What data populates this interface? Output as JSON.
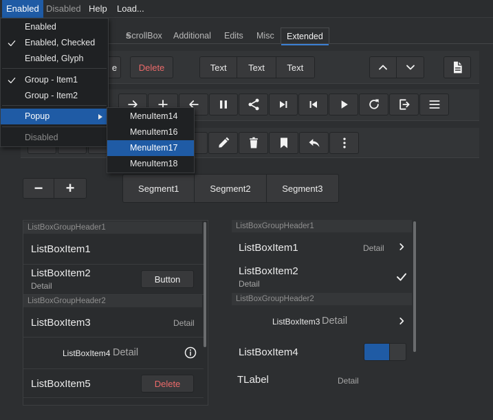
{
  "menubar": {
    "items": [
      {
        "label": "Enabled"
      },
      {
        "label": "Disabled"
      },
      {
        "label": "Help"
      },
      {
        "label": "Load..."
      }
    ]
  },
  "dropdown": {
    "items": [
      {
        "label": "Enabled"
      },
      {
        "label": "Enabled, Checked"
      },
      {
        "label": "Enabled, Glyph"
      },
      {
        "label": "Group - Item1"
      },
      {
        "label": "Group - Item2"
      },
      {
        "label": "Popup"
      },
      {
        "label": "Disabled"
      }
    ],
    "submenu": [
      "MenuItem14",
      "MenuItem16",
      "MenuItem17",
      "MenuItem18"
    ]
  },
  "tabs": [
    {
      "label": "s"
    },
    {
      "label": "ScrollBox"
    },
    {
      "label": "Additional"
    },
    {
      "label": "Edits"
    },
    {
      "label": "Misc"
    },
    {
      "label": "Extended"
    }
  ],
  "row1": {
    "partial_label": "e",
    "delete_label": "Delete",
    "text_segments": [
      "Text",
      "Text",
      "Text"
    ]
  },
  "icons_row2": [
    "arrow-right-icon",
    "plus-icon",
    "arrow-left-icon",
    "pause-icon",
    "share-icon",
    "skip-next-icon",
    "skip-previous-icon",
    "play-icon",
    "refresh-icon",
    "exit-icon",
    "menu-icon"
  ],
  "icons_row3": [
    "pencil-icon",
    "trash-icon",
    "bookmark-icon",
    "reply-icon",
    "more-vertical-icon"
  ],
  "stepper": {
    "minus": "−",
    "plus": "+"
  },
  "segments": [
    "Segment1",
    "Segment2",
    "Segment3"
  ],
  "left_list": {
    "header1": "ListBoxGroupHeader1",
    "item1": "ListBoxItem1",
    "item2": "ListBoxItem2",
    "item2_detail": "Detail",
    "item2_button": "Button",
    "header2": "ListBoxGroupHeader2",
    "item3": "ListBoxItem3",
    "item3_detail": "Detail",
    "item4": "ListBoxItem4",
    "item4_detail": "Detail",
    "item5": "ListBoxItem5",
    "item5_button": "Delete"
  },
  "right_list": {
    "header1": "ListBoxGroupHeader1",
    "item1": "ListBoxItem1",
    "item1_detail": "Detail",
    "item2": "ListBoxItem2",
    "item2_detail": "Detail",
    "header2": "ListBoxGroupHeader2",
    "item3": "ListBoxItem3",
    "item3_detail": "Detail",
    "item4": "ListBoxItem4",
    "label": "TLabel",
    "label_detail": "Detail"
  },
  "colors": {
    "accent": "#1f5ba5",
    "danger": "#ec6a6a",
    "background": "#2d2f31"
  }
}
